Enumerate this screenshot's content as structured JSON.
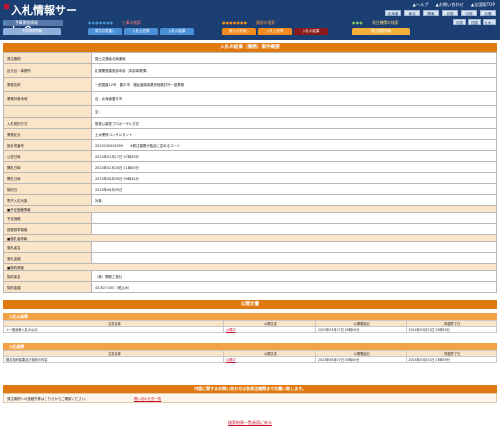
{
  "header": {
    "app_title": "入札情報サービス",
    "top_links": [
      "▲ヘルプ",
      "▲お問い合わせ",
      "▲全国版TOP"
    ],
    "regions_row1": [
      "北海道",
      "東北",
      "関東",
      "北陸",
      "中部",
      "近畿"
    ],
    "regions_row2": [
      "中国",
      "四国",
      "九州・沖縄"
    ],
    "nav_groups": [
      {
        "title": "予算関係情報",
        "tabs": [
          "予算関係情報"
        ]
      },
      {
        "title": "工事の検索",
        "tabs": [
          "発注の見通し",
          "入札公告等",
          "入札の結果"
        ]
      },
      {
        "title": "業務の検索",
        "tabs": [
          "発注の見通し",
          "入札公告等",
          "入札の結果"
        ]
      },
      {
        "title": "発注機関の検索",
        "tabs": [
          "発注機関情報"
        ]
      }
    ]
  },
  "detail": {
    "title": "入札の結果（業務）案件概要",
    "rows": [
      {
        "label": "発注機関",
        "value": "国土交通省北海道局"
      },
      {
        "label": "区分目・事務所",
        "value": "札幌開発建設部本部（本部事業課）"
      },
      {
        "label": "業務名称",
        "value": "一般国道12号　豊平市　福祉道路事業詳細検討外一連業務"
      },
      {
        "label": "業務対象地域",
        "value": "自：北海道豊平市"
      },
      {
        "label": "",
        "value": "至："
      },
      {
        "label": "入札契約方式",
        "value": "簡易公募型プロポーザル方式"
      },
      {
        "label": "業務区分",
        "value": "土木関係コンサルタント"
      },
      {
        "label": "設計書番号",
        "value": "2023230026559　　※発注機関が独自に定めるコード"
      },
      {
        "label": "公告日時",
        "value": "2023年03月17日 07時30分"
      },
      {
        "label": "開札日時",
        "value": "2023年02月24日 11時00分"
      },
      {
        "label": "開札日時",
        "value": "2023年06月05日 09時44分"
      },
      {
        "label": "契約日",
        "value": "2023年06月05日"
      },
      {
        "label": "電子入札対象",
        "value": "対象"
      }
    ],
    "price_section": "■予定価格情報",
    "price_rows": [
      {
        "label": "予定価格",
        "value": ""
      },
      {
        "label": "調査基準価格",
        "value": ""
      }
    ],
    "bid_section": "■落札者情報",
    "bid_rows": [
      {
        "label": "落札者名",
        "value": ""
      },
      {
        "label": "落札金額",
        "value": ""
      }
    ],
    "contract_section": "■契約情報",
    "contract_rows": [
      {
        "label": "契約者名",
        "value": "（株）開発工営社"
      },
      {
        "label": "契約金額",
        "value": "43,807,000（税込み）"
      }
    ]
  },
  "docs": {
    "title": "公開文書",
    "groups": [
      {
        "name": "入札公告等",
        "headers": [
          "文書名称",
          "公開文書",
          "公開開始日",
          "掲載終了日"
        ],
        "rows": [
          [
            "①一般競争入札の公示",
            "公開中",
            "2023年03月17日 00時00分",
            "2024年03月31日 23時59分"
          ]
        ]
      },
      {
        "name": "入札結果",
        "headers": [
          "文書名称",
          "公開文書",
          "公開開始日",
          "掲載終了日"
        ],
        "rows": [
          [
            "随意契約結果及び契約の内容",
            "公開中",
            "2023年06月07日 00時00分",
            "2024年03月31日 23時59分"
          ]
        ]
      }
    ]
  },
  "inquiry": {
    "title": "内容に関するお問い合わせは各発注機関までお願い致します。",
    "text": "発注機関への連絡先等はこちらからご確認ください。",
    "link": "問い合わせ先一覧"
  },
  "footer": {
    "back_link": "検索結果一覧画面に戻る"
  }
}
